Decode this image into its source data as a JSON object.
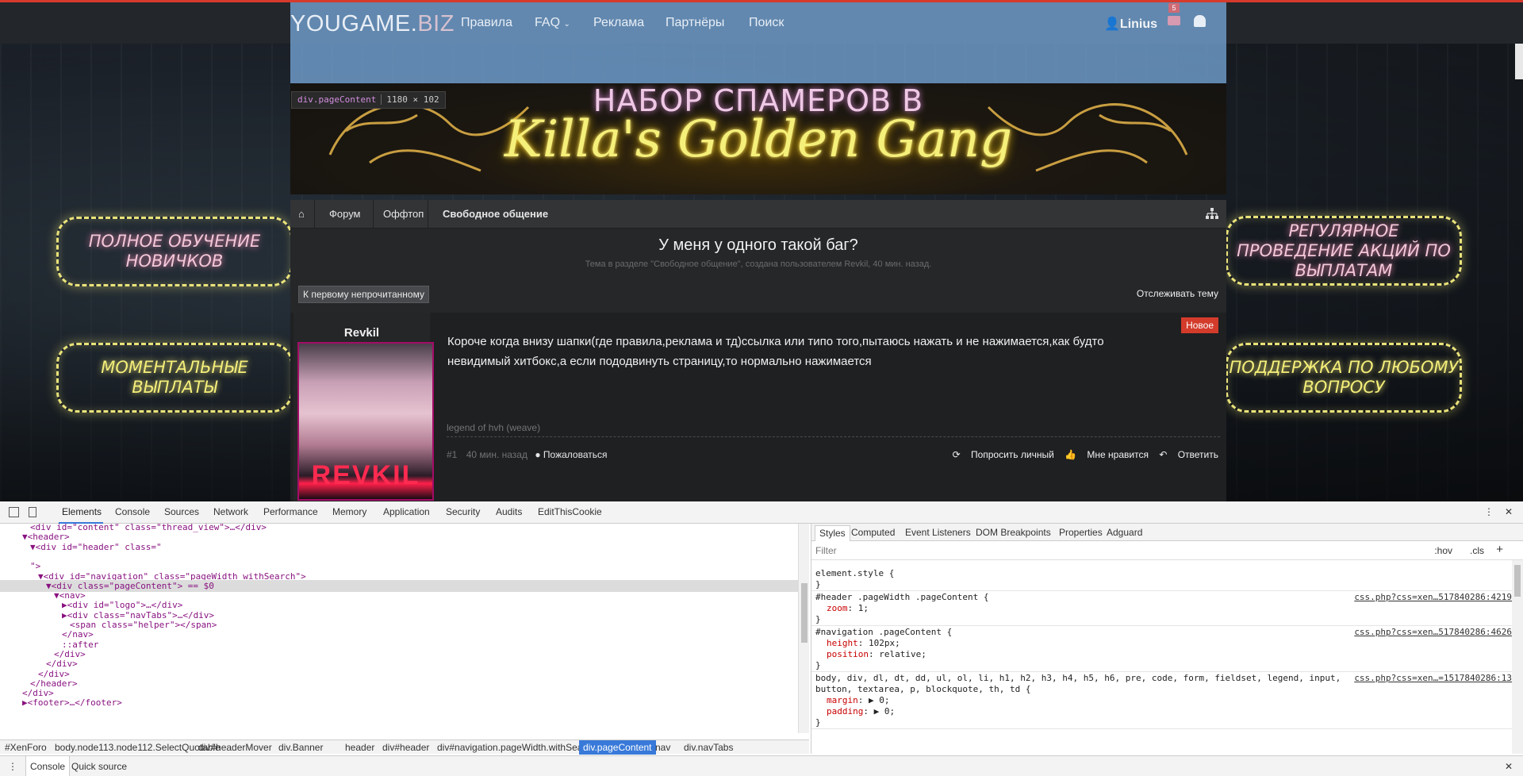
{
  "site": {
    "logo_main": "YOUGAME.",
    "logo_tld": "BIZ",
    "nav": [
      "Правила",
      "FAQ",
      "Реклама",
      "Партнёры",
      "Поиск"
    ],
    "user": "Linius",
    "mail_count": "5"
  },
  "inspect_tooltip": {
    "selector": "div.pageContent",
    "dims": "1180 × 102"
  },
  "banner": {
    "line1": "НАБОР СПАМЕРОВ В",
    "line2": "Killa's Golden Gang"
  },
  "side_banners": {
    "left_top": "ПОЛНОЕ ОБУЧЕНИЕ НОВИЧКОВ",
    "left_bottom": "МОМЕНТАЛЬНЫЕ ВЫПЛАТЫ",
    "right_top": "РЕГУЛЯРНОЕ ПРОВЕДЕНИЕ АКЦИЙ ПО ВЫПЛАТАМ",
    "right_bottom": "ПОДДЕРЖКА ПО ЛЮБОМУ ВОПРОСУ"
  },
  "breadcrumbs": [
    "Форум",
    "Оффтоп",
    "Свободное общение"
  ],
  "thread": {
    "title": "У меня у одного такой баг?",
    "meta": "Тема в разделе \"Свободное общение\", создана пользователем Revkil, 40 мин. назад.",
    "first_unread": "К первому непрочитанному",
    "watch": "Отслеживать тему"
  },
  "post": {
    "author": "Revkil",
    "avatar_text": "REVKIL",
    "badge": "Новое",
    "body": "Короче когда внизу шапки(где правила,реклама и тд)ссылка или типо того,пытаюсь нажать и не нажимается,как будто невидимый хитбокс,а если пододвинуть страницу,то нормально нажимается",
    "signature": "legend of hvh (weave)",
    "number": "#1",
    "time": "40 мин. назад",
    "report": "Пожаловаться",
    "actions": [
      "Попросить личный",
      "Мне нравится",
      "Ответить"
    ]
  },
  "devtools": {
    "tabs": [
      "Elements",
      "Console",
      "Sources",
      "Network",
      "Performance",
      "Memory",
      "Application",
      "Security",
      "Audits",
      "EditThisCookie"
    ],
    "dom_lines": [
      {
        "indent": 5,
        "html": "<div id=\"content\" class=\"thread_view\">…</div>"
      },
      {
        "indent": 4,
        "html": "▼<header>"
      },
      {
        "indent": 5,
        "html": "▼<div id=\"header\" class=\""
      },
      {
        "indent": 0,
        "html": ""
      },
      {
        "indent": 5,
        "html": "\">"
      },
      {
        "indent": 6,
        "html": "▼<div id=\"navigation\" class=\"pageWidth withSearch\">"
      },
      {
        "indent": 7,
        "html": "▼<div class=\"pageContent\"> == $0"
      },
      {
        "indent": 8,
        "html": "▼<nav>"
      },
      {
        "indent": 9,
        "html": "▶<div id=\"logo\">…</div>"
      },
      {
        "indent": 9,
        "html": "▶<div class=\"navTabs\">…</div>"
      },
      {
        "indent": 10,
        "html": "<span class=\"helper\"></span>"
      },
      {
        "indent": 9,
        "html": "</nav>"
      },
      {
        "indent": 9,
        "html": "::after"
      },
      {
        "indent": 8,
        "html": "</div>"
      },
      {
        "indent": 7,
        "html": "</div>"
      },
      {
        "indent": 6,
        "html": "</div>"
      },
      {
        "indent": 5,
        "html": "</header>"
      },
      {
        "indent": 4,
        "html": "</div>"
      },
      {
        "indent": 4,
        "html": "▶<footer>…</footer>"
      }
    ],
    "breadcrumb": [
      "#XenForo",
      "body.node113.node112.SelectQuotable",
      "div#headerMover",
      "div.Banner",
      "header",
      "div#header",
      "div#navigation.pageWidth.withSearch",
      "div.pageContent",
      "nav",
      "div.navTabs"
    ],
    "styles_tabs": [
      "Styles",
      "Computed",
      "Event Listeners",
      "DOM Breakpoints",
      "Properties",
      "Adguard"
    ],
    "filter_placeholder": "Filter",
    "hov": ":hov",
    "cls": ".cls",
    "rules": [
      {
        "selector": "element.style {",
        "src": "",
        "props": []
      },
      {
        "selector": "#header .pageWidth .pageContent {",
        "src": "css.php?css=xen…517840286:4219",
        "props": [
          [
            "zoom",
            "1;"
          ]
        ]
      },
      {
        "selector": "#navigation .pageContent {",
        "src": "css.php?css=xen…517840286:4626",
        "props": [
          [
            "height",
            "102px;"
          ],
          [
            "position",
            "relative;"
          ]
        ]
      },
      {
        "selector": "body, div, dl, dt, dd, ul, ol, li, h1, h2, h3, h4, h5, h6, pre, code, form, fieldset, legend, input,",
        "selector2": "button, textarea, p, blockquote, th, td {",
        "src": "css.php?css=xen…=1517840286:13",
        "props": [
          [
            "margin",
            "▶ 0;"
          ],
          [
            "padding",
            "▶ 0;"
          ]
        ]
      }
    ],
    "drawer_tabs": [
      "Console",
      "Quick source"
    ]
  }
}
